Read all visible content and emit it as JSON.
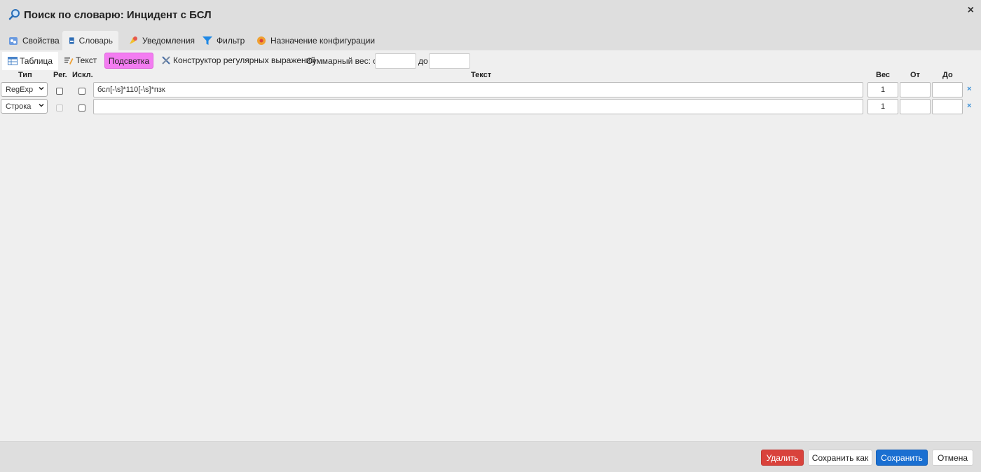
{
  "title": "Поиск по словарю: Инцидент с БСЛ",
  "close_label": "×",
  "tabs": [
    {
      "label": "Свойства",
      "icon": "properties-icon"
    },
    {
      "label": "Словарь",
      "icon": "dictionary-icon"
    },
    {
      "label": "Уведомления",
      "icon": "notifications-icon"
    },
    {
      "label": "Фильтр",
      "icon": "filter-icon"
    },
    {
      "label": "Назначение конфигурации",
      "icon": "config-assignment-icon"
    }
  ],
  "subtabs": [
    {
      "label": "Таблица",
      "icon": "table-icon"
    },
    {
      "label": "Текст",
      "icon": "text-edit-icon"
    }
  ],
  "highlight_label": "Подсветка",
  "regex_constructor_label": "Конструктор регулярных выражений",
  "total_weight": {
    "label_from": "Суммарный вес: от",
    "label_to": "до",
    "from_value": "",
    "to_value": ""
  },
  "columns": {
    "type": "Тип",
    "reg": "Рег.",
    "excl": "Искл.",
    "text": "Текст",
    "weight": "Вес",
    "from": "От",
    "to": "До"
  },
  "rows": [
    {
      "type": "RegExp",
      "reg_checked": false,
      "excl_checked": false,
      "text": "бсл[-\\s]*110[-\\s]*пзк",
      "weight": "1",
      "from": "",
      "to": ""
    },
    {
      "type": "Строка",
      "reg_checked": false,
      "excl_checked": false,
      "text": "",
      "weight": "1",
      "from": "",
      "to": ""
    }
  ],
  "row_delete_label": "×",
  "footer": {
    "delete": "Удалить",
    "save_as": "Сохранить как",
    "save": "Сохранить",
    "cancel": "Отмена"
  },
  "colors": {
    "highlight": "#f37cf1",
    "delete_button": "#d9423c",
    "save_button": "#1a6fd1"
  }
}
